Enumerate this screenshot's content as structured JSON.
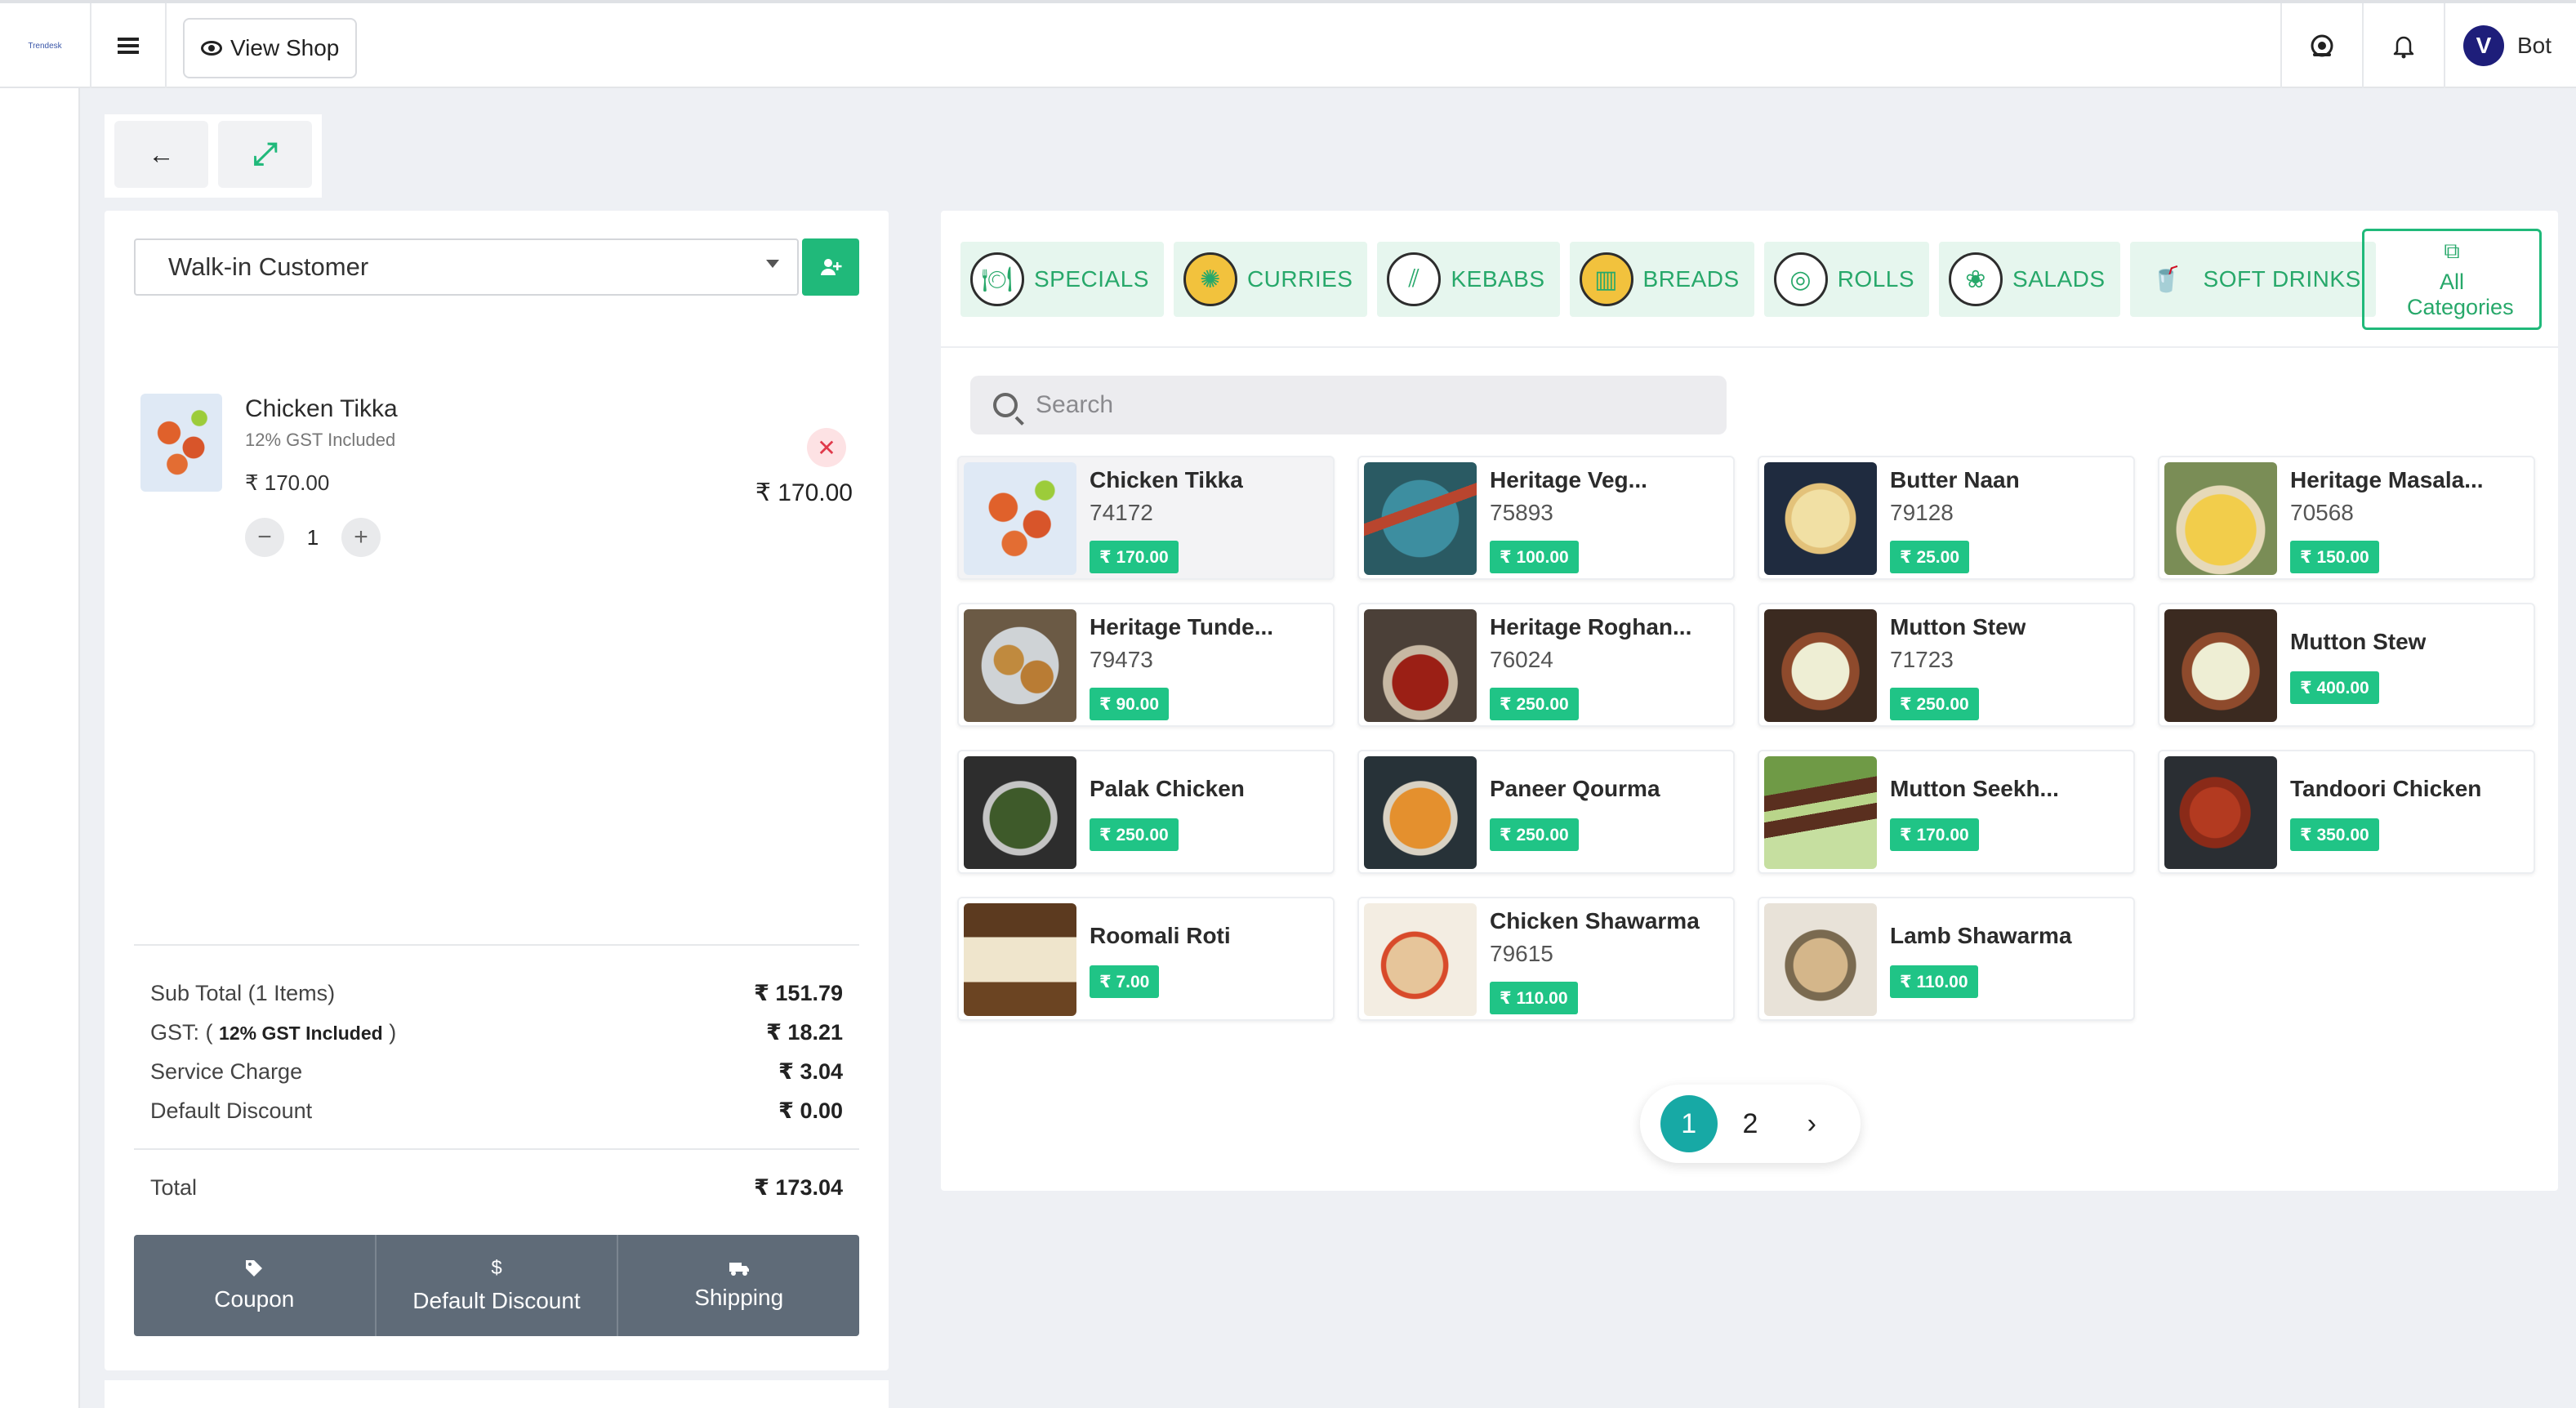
{
  "header": {
    "brand_text": "Trendesk",
    "view_shop_label": "View Shop",
    "user_initial": "V",
    "user_name": "Bot"
  },
  "toolbar": {
    "back_icon": "←",
    "expand_icon": "⤢"
  },
  "cart": {
    "customer": "Walk-in Customer",
    "items": [
      {
        "name": "Chicken Tikka",
        "tax_note": "12% GST Included",
        "unit_price": "₹ 170.00",
        "line_total": "₹ 170.00",
        "quantity": "1"
      }
    ],
    "summary": {
      "subtotal_label": "Sub Total (1 Items)",
      "subtotal_value": "₹ 151.79",
      "gst_label_prefix": "GST: (",
      "gst_label_bold": "12% GST Included",
      "gst_label_suffix": ")",
      "gst_value": "₹ 18.21",
      "service_label": "Service Charge",
      "service_value": "₹ 3.04",
      "discount_label": "Default Discount",
      "discount_value": "₹ 0.00",
      "total_label": "Total",
      "total_value": "₹ 173.04"
    },
    "actions": [
      {
        "label": "Coupon",
        "icon": "tag-icon"
      },
      {
        "label": "Default Discount",
        "icon": "dollar-icon"
      },
      {
        "label": "Shipping",
        "icon": "truck-icon"
      }
    ]
  },
  "categories": [
    {
      "label": "SPECIALS",
      "icon": "cloche-icon"
    },
    {
      "label": "CURRIES",
      "icon": "curry-icon"
    },
    {
      "label": "KEBABS",
      "icon": "kebab-icon"
    },
    {
      "label": "BREADS",
      "icon": "bread-icon"
    },
    {
      "label": "ROLLS",
      "icon": "roll-icon"
    },
    {
      "label": "SALADS",
      "icon": "salad-icon"
    },
    {
      "label": "SOFT DRINKS",
      "icon": "drinks-icon"
    }
  ],
  "all_categories_label": "All Categories",
  "search": {
    "placeholder": "Search"
  },
  "products": [
    {
      "name": "Chicken Tikka",
      "code": "74172",
      "price": "₹ 170.00"
    },
    {
      "name": "Heritage Veg...",
      "code": "75893",
      "price": "₹ 100.00"
    },
    {
      "name": "Butter Naan",
      "code": "79128",
      "price": "₹ 25.00"
    },
    {
      "name": "Heritage Masala...",
      "code": "70568",
      "price": "₹ 150.00"
    },
    {
      "name": "Heritage Tunde...",
      "code": "79473",
      "price": "₹ 90.00"
    },
    {
      "name": "Heritage Roghan...",
      "code": "76024",
      "price": "₹ 250.00"
    },
    {
      "name": "Mutton Stew",
      "code": "71723",
      "price": "₹ 250.00"
    },
    {
      "name": "Mutton Stew",
      "code": "",
      "price": "₹ 400.00"
    },
    {
      "name": "Palak Chicken",
      "code": "",
      "price": "₹ 250.00"
    },
    {
      "name": "Paneer Qourma",
      "code": "",
      "price": "₹ 250.00"
    },
    {
      "name": "Mutton Seekh...",
      "code": "",
      "price": "₹ 170.00"
    },
    {
      "name": "Tandoori Chicken",
      "code": "",
      "price": "₹ 350.00"
    },
    {
      "name": "Roomali Roti",
      "code": "",
      "price": "₹ 7.00"
    },
    {
      "name": "Chicken Shawarma",
      "code": "79615",
      "price": "₹ 110.00"
    },
    {
      "name": "Lamb Shawarma",
      "code": "",
      "price": "₹ 110.00"
    }
  ],
  "pagination": {
    "pages": [
      "1",
      "2"
    ],
    "current": "1",
    "next_icon": "›"
  }
}
